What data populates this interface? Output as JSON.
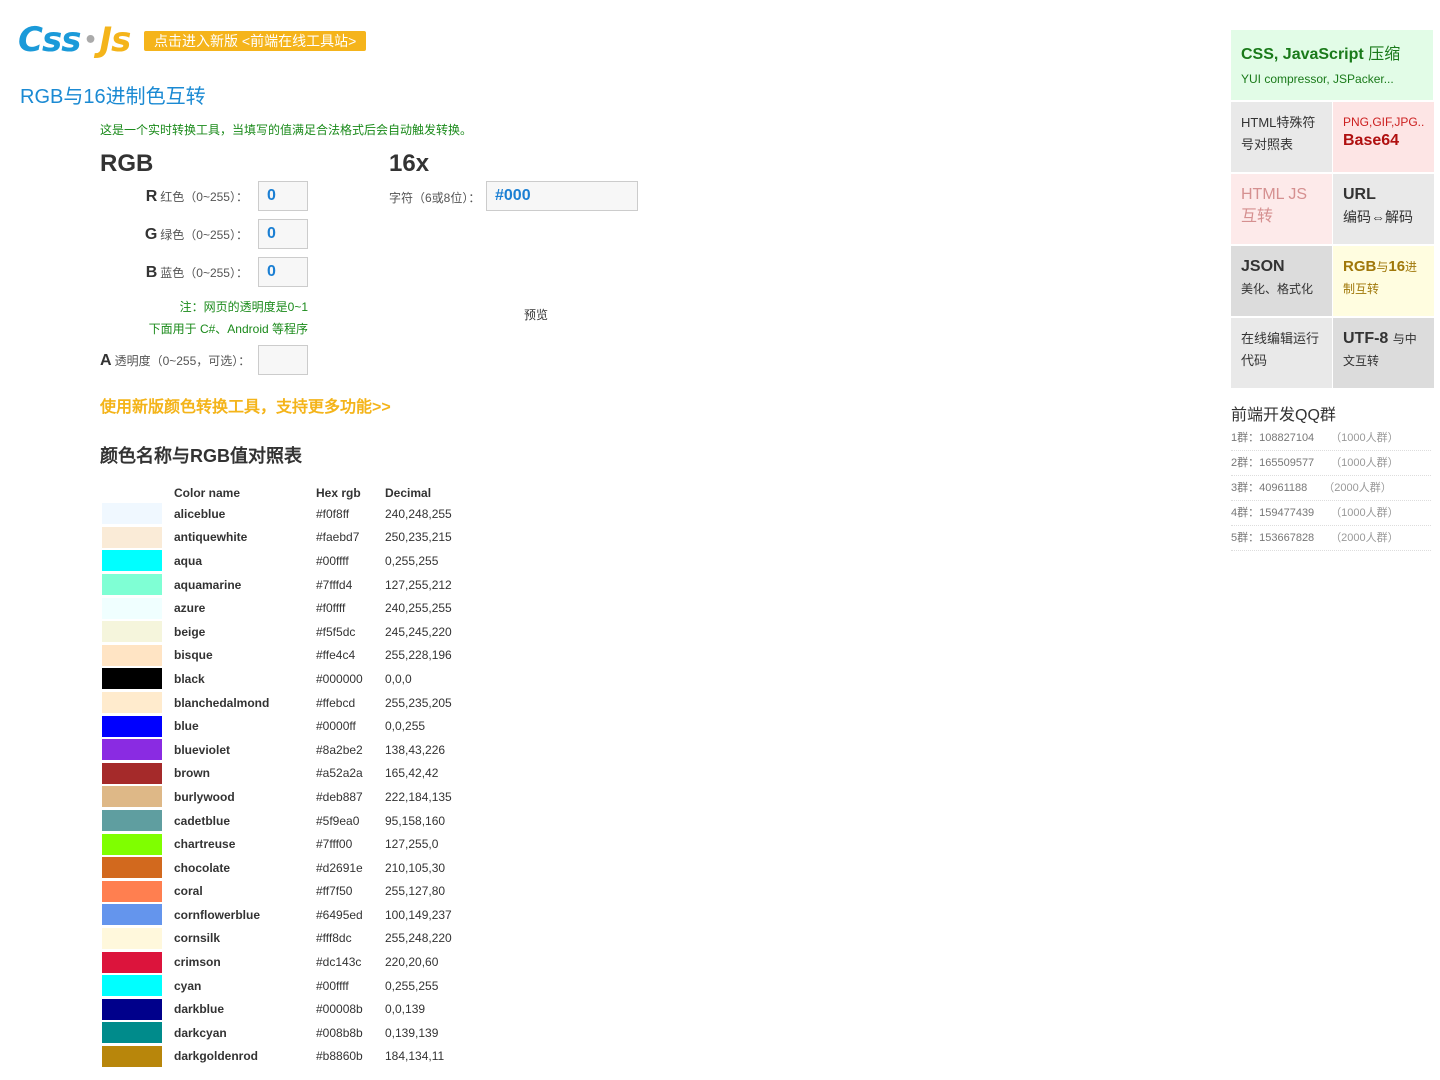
{
  "header": {
    "logo_part1": "Css",
    "logo_dot": "•",
    "logo_part2": "Js",
    "new_version_badge": "点击进入新版 <前端在线工具站>",
    "page_title": "RGB与16进制色互转"
  },
  "converter": {
    "intro_note": "这是一个实时转换工具，当填写的值满足合法格式后会自动触发转换。",
    "rgb_title": "RGB",
    "hex_title": "16x",
    "r_letter": "R",
    "r_label": "红色（0~255）：",
    "r_value": "0",
    "g_letter": "G",
    "g_label": "绿色（0~255）：",
    "g_value": "0",
    "b_letter": "B",
    "b_label": "蓝色（0~255）：",
    "b_value": "0",
    "alpha_note_1": "注：网页的透明度是0~1",
    "alpha_note_2": "下面用于 C#、Android 等程序",
    "a_letter": "A",
    "a_label": "透明度（0~255，可选）：",
    "a_value": "",
    "hex_label": "字符（6或8位）：",
    "hex_value": "#000",
    "preview_label": "预览",
    "new_tool_link": "使用新版颜色转换工具，支持更多功能>>"
  },
  "table": {
    "title": "颜色名称与RGB值对照表",
    "headers": [
      "",
      "Color name",
      "Hex rgb",
      "Decimal"
    ],
    "rows": [
      {
        "name": "aliceblue",
        "hex": "#f0f8ff",
        "dec": "240,248,255"
      },
      {
        "name": "antiquewhite",
        "hex": "#faebd7",
        "dec": "250,235,215"
      },
      {
        "name": "aqua",
        "hex": "#00ffff",
        "dec": "0,255,255"
      },
      {
        "name": "aquamarine",
        "hex": "#7fffd4",
        "dec": "127,255,212"
      },
      {
        "name": "azure",
        "hex": "#f0ffff",
        "dec": "240,255,255"
      },
      {
        "name": "beige",
        "hex": "#f5f5dc",
        "dec": "245,245,220"
      },
      {
        "name": "bisque",
        "hex": "#ffe4c4",
        "dec": "255,228,196"
      },
      {
        "name": "black",
        "hex": "#000000",
        "dec": "0,0,0"
      },
      {
        "name": "blanchedalmond",
        "hex": "#ffebcd",
        "dec": "255,235,205"
      },
      {
        "name": "blue",
        "hex": "#0000ff",
        "dec": "0,0,255"
      },
      {
        "name": "blueviolet",
        "hex": "#8a2be2",
        "dec": "138,43,226"
      },
      {
        "name": "brown",
        "hex": "#a52a2a",
        "dec": "165,42,42"
      },
      {
        "name": "burlywood",
        "hex": "#deb887",
        "dec": "222,184,135"
      },
      {
        "name": "cadetblue",
        "hex": "#5f9ea0",
        "dec": "95,158,160"
      },
      {
        "name": "chartreuse",
        "hex": "#7fff00",
        "dec": "127,255,0"
      },
      {
        "name": "chocolate",
        "hex": "#d2691e",
        "dec": "210,105,30"
      },
      {
        "name": "coral",
        "hex": "#ff7f50",
        "dec": "255,127,80"
      },
      {
        "name": "cornflowerblue",
        "hex": "#6495ed",
        "dec": "100,149,237"
      },
      {
        "name": "cornsilk",
        "hex": "#fff8dc",
        "dec": "255,248,220"
      },
      {
        "name": "crimson",
        "hex": "#dc143c",
        "dec": "220,20,60"
      },
      {
        "name": "cyan",
        "hex": "#00ffff",
        "dec": "0,255,255"
      },
      {
        "name": "darkblue",
        "hex": "#00008b",
        "dec": "0,0,139"
      },
      {
        "name": "darkcyan",
        "hex": "#008b8b",
        "dec": "0,139,139"
      },
      {
        "name": "darkgoldenrod",
        "hex": "#b8860b",
        "dec": "184,134,11"
      }
    ]
  },
  "sidebar": {
    "compress_title": "CSS, JavaScript",
    "compress_title_suffix": "压缩",
    "compress_sub": "YUI compressor, JSPacker...",
    "html_char": "HTML特殊符号对照表",
    "base64_sub": "PNG,GIF,JPG...",
    "base64_title": "Base64",
    "html_js": "HTML JS互转",
    "url_title": "URL",
    "url_sub": "编码⇔解码",
    "json_title": "JSON",
    "json_sub": "美化、格式化",
    "rgb_b1": "RGB",
    "rgb_s1": "与",
    "rgb_b2": "16",
    "rgb_s2": "进制互转",
    "editor": "在线编辑运行代码",
    "utf8_title": "UTF-8",
    "utf8_sub": "与中文互转",
    "qq_title": "前端开发QQ群",
    "qq_groups": [
      {
        "label": "1群：108827104",
        "cap": "（1000人群）"
      },
      {
        "label": "2群：165509577",
        "cap": "（1000人群）"
      },
      {
        "label": "3群：40961188",
        "cap": "（2000人群）"
      },
      {
        "label": "4群：159477439",
        "cap": "（1000人群）"
      },
      {
        "label": "5群：153667828",
        "cap": "（2000人群）"
      }
    ]
  },
  "colors": {
    "accent_blue": "#1b8ad3",
    "accent_orange": "#f5b41b",
    "note_green": "#1a8a1a"
  }
}
